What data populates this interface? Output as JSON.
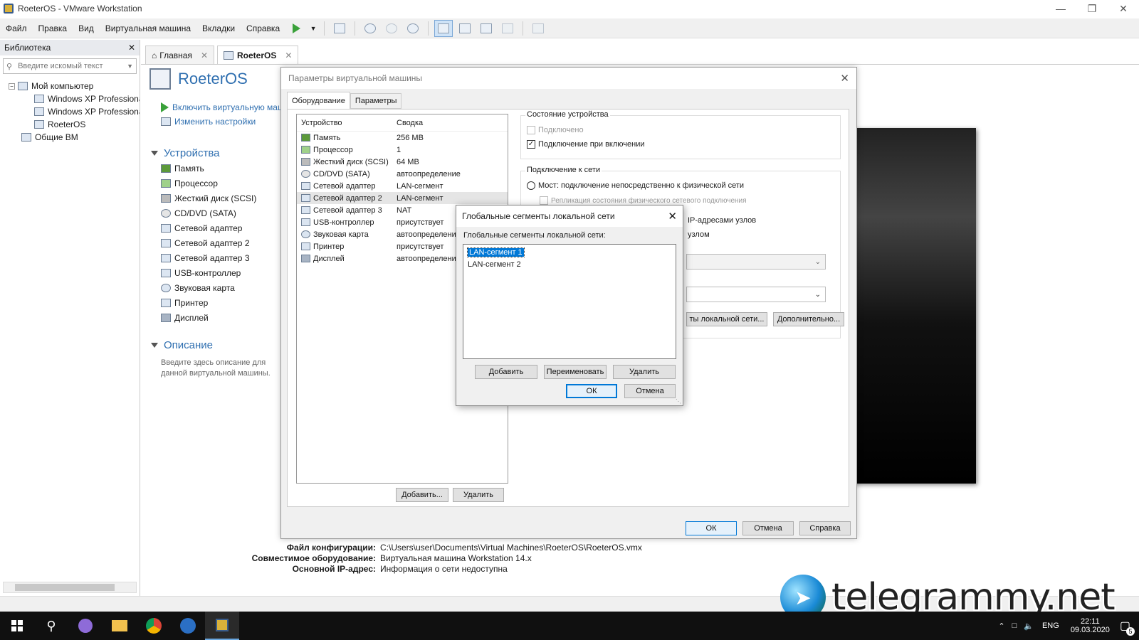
{
  "window": {
    "title": "RoeterOS - VMware Workstation"
  },
  "menu": [
    "Файл",
    "Правка",
    "Вид",
    "Виртуальная машина",
    "Вкладки",
    "Справка"
  ],
  "library": {
    "title": "Библиотека",
    "search_placeholder": "Введите искомый текст",
    "tree": {
      "root": "Мой компьютер",
      "vm1": "Windows XP Professional",
      "vm2": "Windows XP Professional",
      "vm3": "RoeterOS",
      "shared": "Общие ВМ"
    }
  },
  "tabs": {
    "home": "Главная",
    "vm": "RoeterOS"
  },
  "vm": {
    "name": "RoeterOS",
    "power_on": "Включить виртуальную машину",
    "edit_settings": "Изменить настройки",
    "devices_title": "Устройства",
    "devices": [
      "Память",
      "Процессор",
      "Жесткий диск (SCSI)",
      "CD/DVD (SATA)",
      "Сетевой адаптер",
      "Сетевой адаптер 2",
      "Сетевой адаптер 3",
      "USB-контроллер",
      "Звуковая карта",
      "Принтер",
      "Дисплей"
    ],
    "description_title": "Описание",
    "description_placeholder": "Введите здесь описание для данной виртуальной машины."
  },
  "details": {
    "config_label": "Файл конфигурации:",
    "config_value": "C:\\Users\\user\\Documents\\Virtual Machines\\RoeterOS\\RoeterOS.vmx",
    "compat_label": "Совместимое оборудование:",
    "compat_value": "Виртуальная машина Workstation 14.x",
    "ip_label": "Основной IP-адрес:",
    "ip_value": "Информация о сети недоступна"
  },
  "settings_dialog": {
    "title": "Параметры виртуальной машины",
    "tab_hardware": "Оборудование",
    "tab_options": "Параметры",
    "col_device": "Устройство",
    "col_summary": "Сводка",
    "hardware": [
      {
        "device": "Память",
        "summary": "256 MB"
      },
      {
        "device": "Процессор",
        "summary": "1"
      },
      {
        "device": "Жесткий диск (SCSI)",
        "summary": "64 MB"
      },
      {
        "device": "CD/DVD (SATA)",
        "summary": "автоопределение"
      },
      {
        "device": "Сетевой адаптер",
        "summary": "LAN-сегмент"
      },
      {
        "device": "Сетевой адаптер 2",
        "summary": "LAN-сегмент"
      },
      {
        "device": "Сетевой адаптер 3",
        "summary": "NAT"
      },
      {
        "device": "USB-контроллер",
        "summary": "присутствует"
      },
      {
        "device": "Звуковая карта",
        "summary": "автоопределение"
      },
      {
        "device": "Принтер",
        "summary": "присутствует"
      },
      {
        "device": "Дисплей",
        "summary": "автоопределение"
      }
    ],
    "add_button": "Добавить...",
    "remove_button": "Удалить",
    "device_status_title": "Состояние устройства",
    "connected": "Подключено",
    "connect_on_power": "Подключение при включении",
    "network_title": "Подключение к сети",
    "bridged": "Мост: подключение непосредственно к физической сети",
    "replicate": "Репликация состояния физического сетевого подключения",
    "nat_partial": "IP-адресами узлов",
    "hostonly_partial": "узлом",
    "lan_segments_button": "ты локальной сети...",
    "advanced_button": "Дополнительно...",
    "ok": "ОК",
    "cancel": "Отмена",
    "help": "Справка"
  },
  "segments_dialog": {
    "title": "Глобальные сегменты локальной сети",
    "list_label": "Глобальные сегменты локальной сети:",
    "items": [
      "LAN-сегмент 1",
      "LAN-сегмент 2"
    ],
    "add": "Добавить",
    "rename": "Переименовать",
    "delete": "Удалить",
    "ok": "ОК",
    "cancel": "Отмена"
  },
  "taskbar": {
    "lang": "ENG",
    "time": "22:11",
    "date": "09.03.2020",
    "notif_count": "5"
  },
  "watermark": {
    "text": "telegrammy.net"
  },
  "colors": {
    "accent": "#0078d7",
    "link": "#2f6fb0",
    "play": "#3aa13a"
  }
}
